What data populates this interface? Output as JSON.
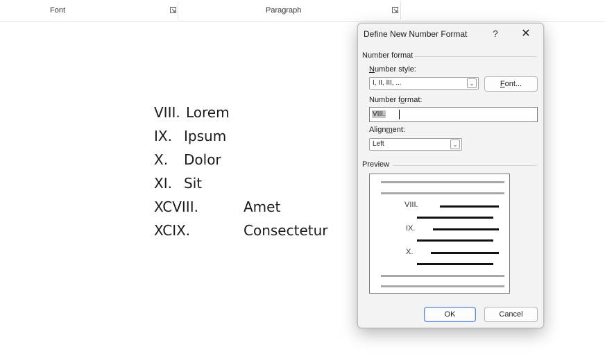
{
  "ribbon": {
    "groups": [
      {
        "label": "Font",
        "launcher_icon": "dialog-launcher-icon"
      },
      {
        "label": "Paragraph",
        "launcher_icon": "dialog-launcher-icon"
      }
    ]
  },
  "document": {
    "items": [
      {
        "number": "VIII.",
        "text": "Lorem"
      },
      {
        "number": "IX.",
        "text": "Ipsum"
      },
      {
        "number": "X.",
        "text": "Dolor"
      },
      {
        "number": "XI.",
        "text": "Sit"
      },
      {
        "number": "XCVIII.",
        "text": "Amet"
      },
      {
        "number": "XCIX.",
        "text": "Consectetur"
      }
    ]
  },
  "dialog": {
    "title": "Define New Number Format",
    "help_label": "?",
    "close_label": "✕",
    "number_format_section": "Number format",
    "number_style": {
      "label_pre": "",
      "label_ul": "N",
      "label_post": "umber style:",
      "value": "I, II, III, ..."
    },
    "font_button": {
      "ul": "F",
      "rest": "ont..."
    },
    "number_format_field": {
      "label_pre": "Number f",
      "label_ul": "o",
      "label_post": "rmat:",
      "value": "VIII."
    },
    "alignment": {
      "label_pre": "Align",
      "label_ul": "m",
      "label_post": "ent:",
      "value": "Left"
    },
    "preview_section": "Preview",
    "preview_numbers": [
      "VIII.",
      "IX.",
      "X."
    ],
    "ok_label": "OK",
    "cancel_label": "Cancel"
  }
}
